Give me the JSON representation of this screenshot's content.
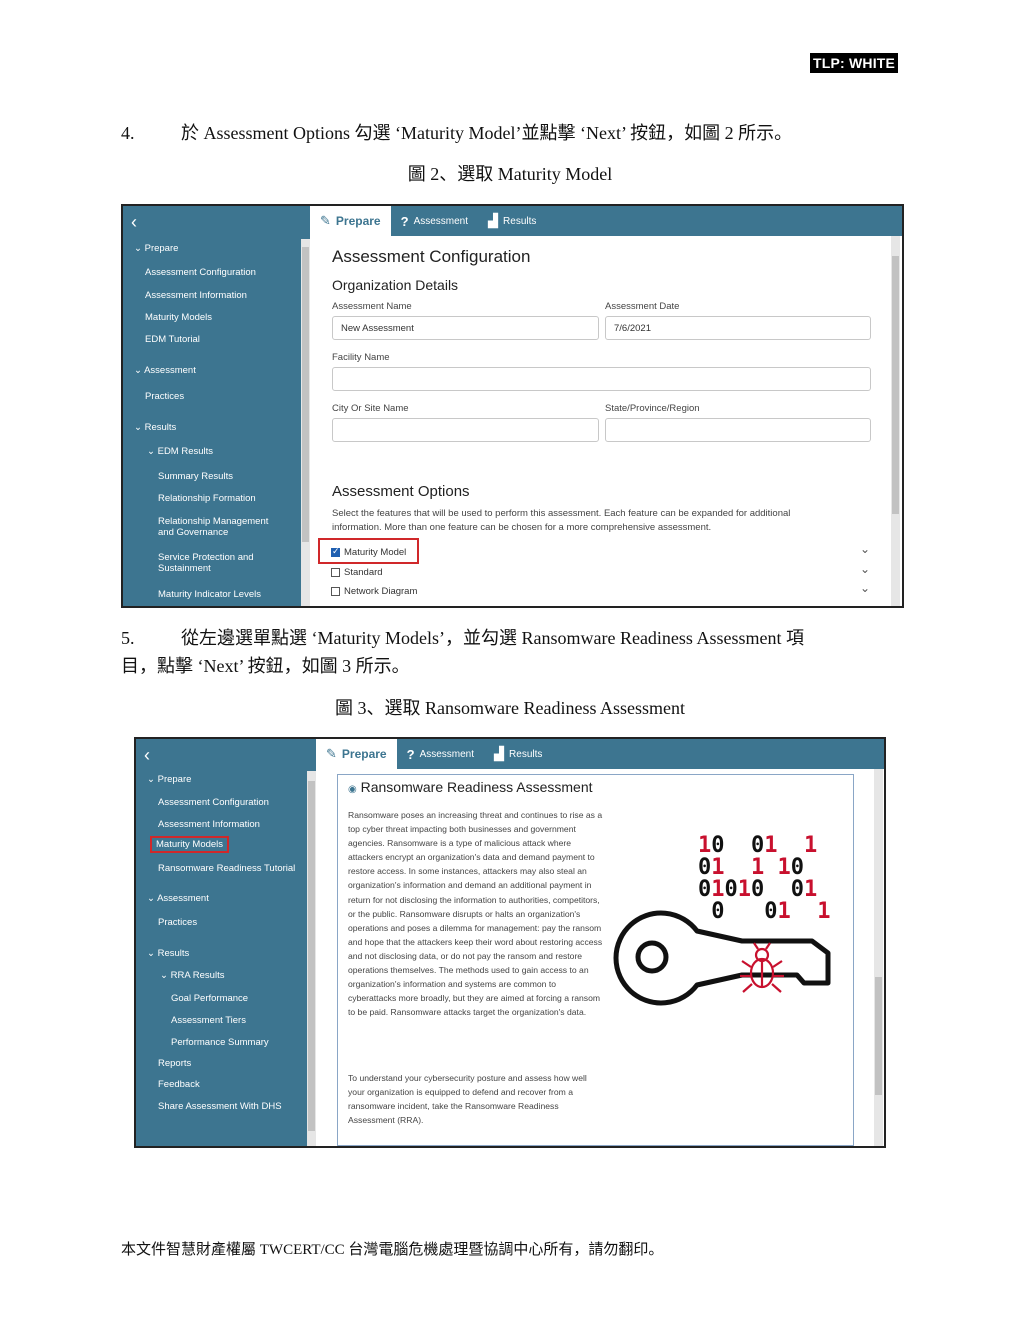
{
  "tlp": "TLP: WHITE",
  "step4": {
    "num": "4.",
    "text": "於 Assessment Options 勾選 ‘Maturity Model’並點擊 ‘Next’ 按鈕，如圖 2 所示。"
  },
  "fig2_caption": "圖 2、選取 Maturity Model",
  "step5": {
    "num": "5.",
    "line1": "從左邊選單點選 ‘Maturity Models’，並勾選 Ransomware Readiness Assessment 項",
    "line2": "目，點擊 ‘Next’ 按鈕，如圖 3 所示。"
  },
  "fig3_caption": "圖 3、選取 Ransomware Readiness Assessment",
  "footer": "本文件智慧財產權屬 TWCERT/CC 台灣電腦危機處理暨協調中心所有，請勿翻印。",
  "tabs": {
    "prepare": "Prepare",
    "assessment": "Assessment",
    "results": "Results"
  },
  "shot1": {
    "nav": {
      "prepare": "Prepare",
      "assessment_config": "Assessment Configuration",
      "assessment_info": "Assessment Information",
      "maturity_models": "Maturity Models",
      "edm_tutorial": "EDM Tutorial",
      "assessment": "Assessment",
      "practices": "Practices",
      "results": "Results",
      "edm_results": "EDM Results",
      "summary_results": "Summary Results",
      "relationship_formation": "Relationship Formation",
      "relationship_mgmt_1": "Relationship Management",
      "relationship_mgmt_2": "and Governance",
      "service_protection_1": "Service Protection and",
      "service_protection_2": "Sustainment",
      "maturity_indicator": "Maturity Indicator Levels"
    },
    "page_title": "Assessment Configuration",
    "org_details": "Organization Details",
    "assessment_name_label": "Assessment Name",
    "assessment_name_value": "New Assessment",
    "assessment_date_label": "Assessment Date",
    "assessment_date_value": "7/6/2021",
    "facility_label": "Facility Name",
    "city_label": "City Or Site Name",
    "state_label": "State/Province/Region",
    "options_title": "Assessment Options",
    "options_desc_1": "Select the features that will be used to perform this assessment. Each feature can be expanded for additional",
    "options_desc_2": "information. More than one feature can be chosen for a more comprehensive assessment.",
    "opt_maturity": "Maturity Model",
    "opt_standard": "Standard",
    "opt_network": "Network Diagram",
    "opt_maturity_checked": true
  },
  "shot2": {
    "nav": {
      "prepare": "Prepare",
      "assessment_config": "Assessment Configuration",
      "assessment_info": "Assessment Information",
      "maturity_models": "Maturity Models",
      "rra_tutorial": "Ransomware Readiness Tutorial",
      "assessment": "Assessment",
      "practices": "Practices",
      "results": "Results",
      "rra_results": "RRA Results",
      "goal_performance": "Goal Performance",
      "assessment_tiers": "Assessment Tiers",
      "performance_summary": "Performance Summary",
      "reports": "Reports",
      "feedback": "Feedback",
      "share": "Share Assessment With DHS"
    },
    "card_title": "Ransomware Readiness Assessment",
    "para1": "Ransomware poses an increasing threat and continues to rise as a top cyber threat impacting both businesses and government agencies. Ransomware is a type of malicious attack where attackers encrypt an organization's data and demand payment to restore access. In some instances, attackers may also steal an organization's information and demand an additional payment in return for not disclosing the information to authorities, competitors, or the public. Ransomware disrupts or halts an organization's operations and poses a dilemma for management: pay the ransom and hope that the attackers keep their word about restoring access and not disclosing data, or do not pay the ransom and restore operations themselves. The methods used to gain access to an organization's information and systems are common to cyberattacks more broadly, but they are aimed at forcing a ransom to be paid. Ransomware attacks target the organization's data.",
    "para2": "To understand your cybersecurity posture and assess how well your organization is equipped to defend and recover from a ransomware incident, take the Ransomware Readiness Assessment (RRA).",
    "accent_color": "#3d7590",
    "highlight_color": "#d0282a"
  }
}
